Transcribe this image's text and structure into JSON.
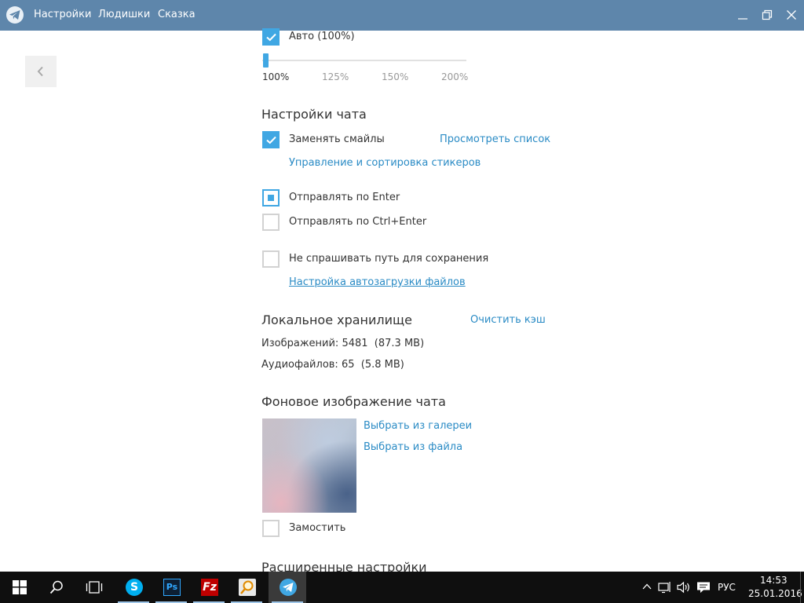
{
  "titlebar": {
    "menu": [
      "Настройки",
      "Людишки",
      "Сказка"
    ]
  },
  "scale": {
    "auto_label": "Авто (100%)",
    "ticks": [
      "100%",
      "125%",
      "150%",
      "200%"
    ],
    "value_percent": 100
  },
  "chat_settings": {
    "title": "Настройки чата",
    "replace_emoji": "Заменять смайлы",
    "view_list": "Просмотреть список",
    "manage_stickers": "Управление и сортировка стикеров",
    "send_enter": "Отправлять по Enter",
    "send_ctrl_enter": "Отправлять по Ctrl+Enter",
    "dont_ask_path": "Не спрашивать путь для сохранения",
    "autodownload": "Настройка автозагрузки файлов"
  },
  "local_storage": {
    "title": "Локальное хранилище",
    "clear_cache": "Очистить кэш",
    "images": "Изображений: 5481  (87.3 MB)",
    "audio": "Аудиофайлов: 65  (5.8 MB)"
  },
  "background": {
    "title": "Фоновое изображение чата",
    "from_gallery": "Выбрать из галереи",
    "from_file": "Выбрать из файла",
    "tile": "Замостить"
  },
  "advanced": {
    "title": "Расширенные настройки"
  },
  "taskbar": {
    "language": "РУС",
    "time": "14:53",
    "date": "25.01.2016"
  },
  "icons": [
    "telegram-logo",
    "minimize-icon",
    "maximize-icon",
    "close-icon",
    "back-arrow-icon",
    "windows-start-icon",
    "search-icon",
    "task-view-icon",
    "skype-icon",
    "photoshop-icon",
    "filezilla-icon",
    "search-tool-icon",
    "telegram-icon",
    "chevron-up-icon",
    "network-icon",
    "volume-icon",
    "notifications-icon"
  ],
  "colors": {
    "titlebar": "#5e86ab",
    "accent": "#40a7e3",
    "link": "#2a8bc5",
    "taskbar": "#0f0f0f"
  }
}
